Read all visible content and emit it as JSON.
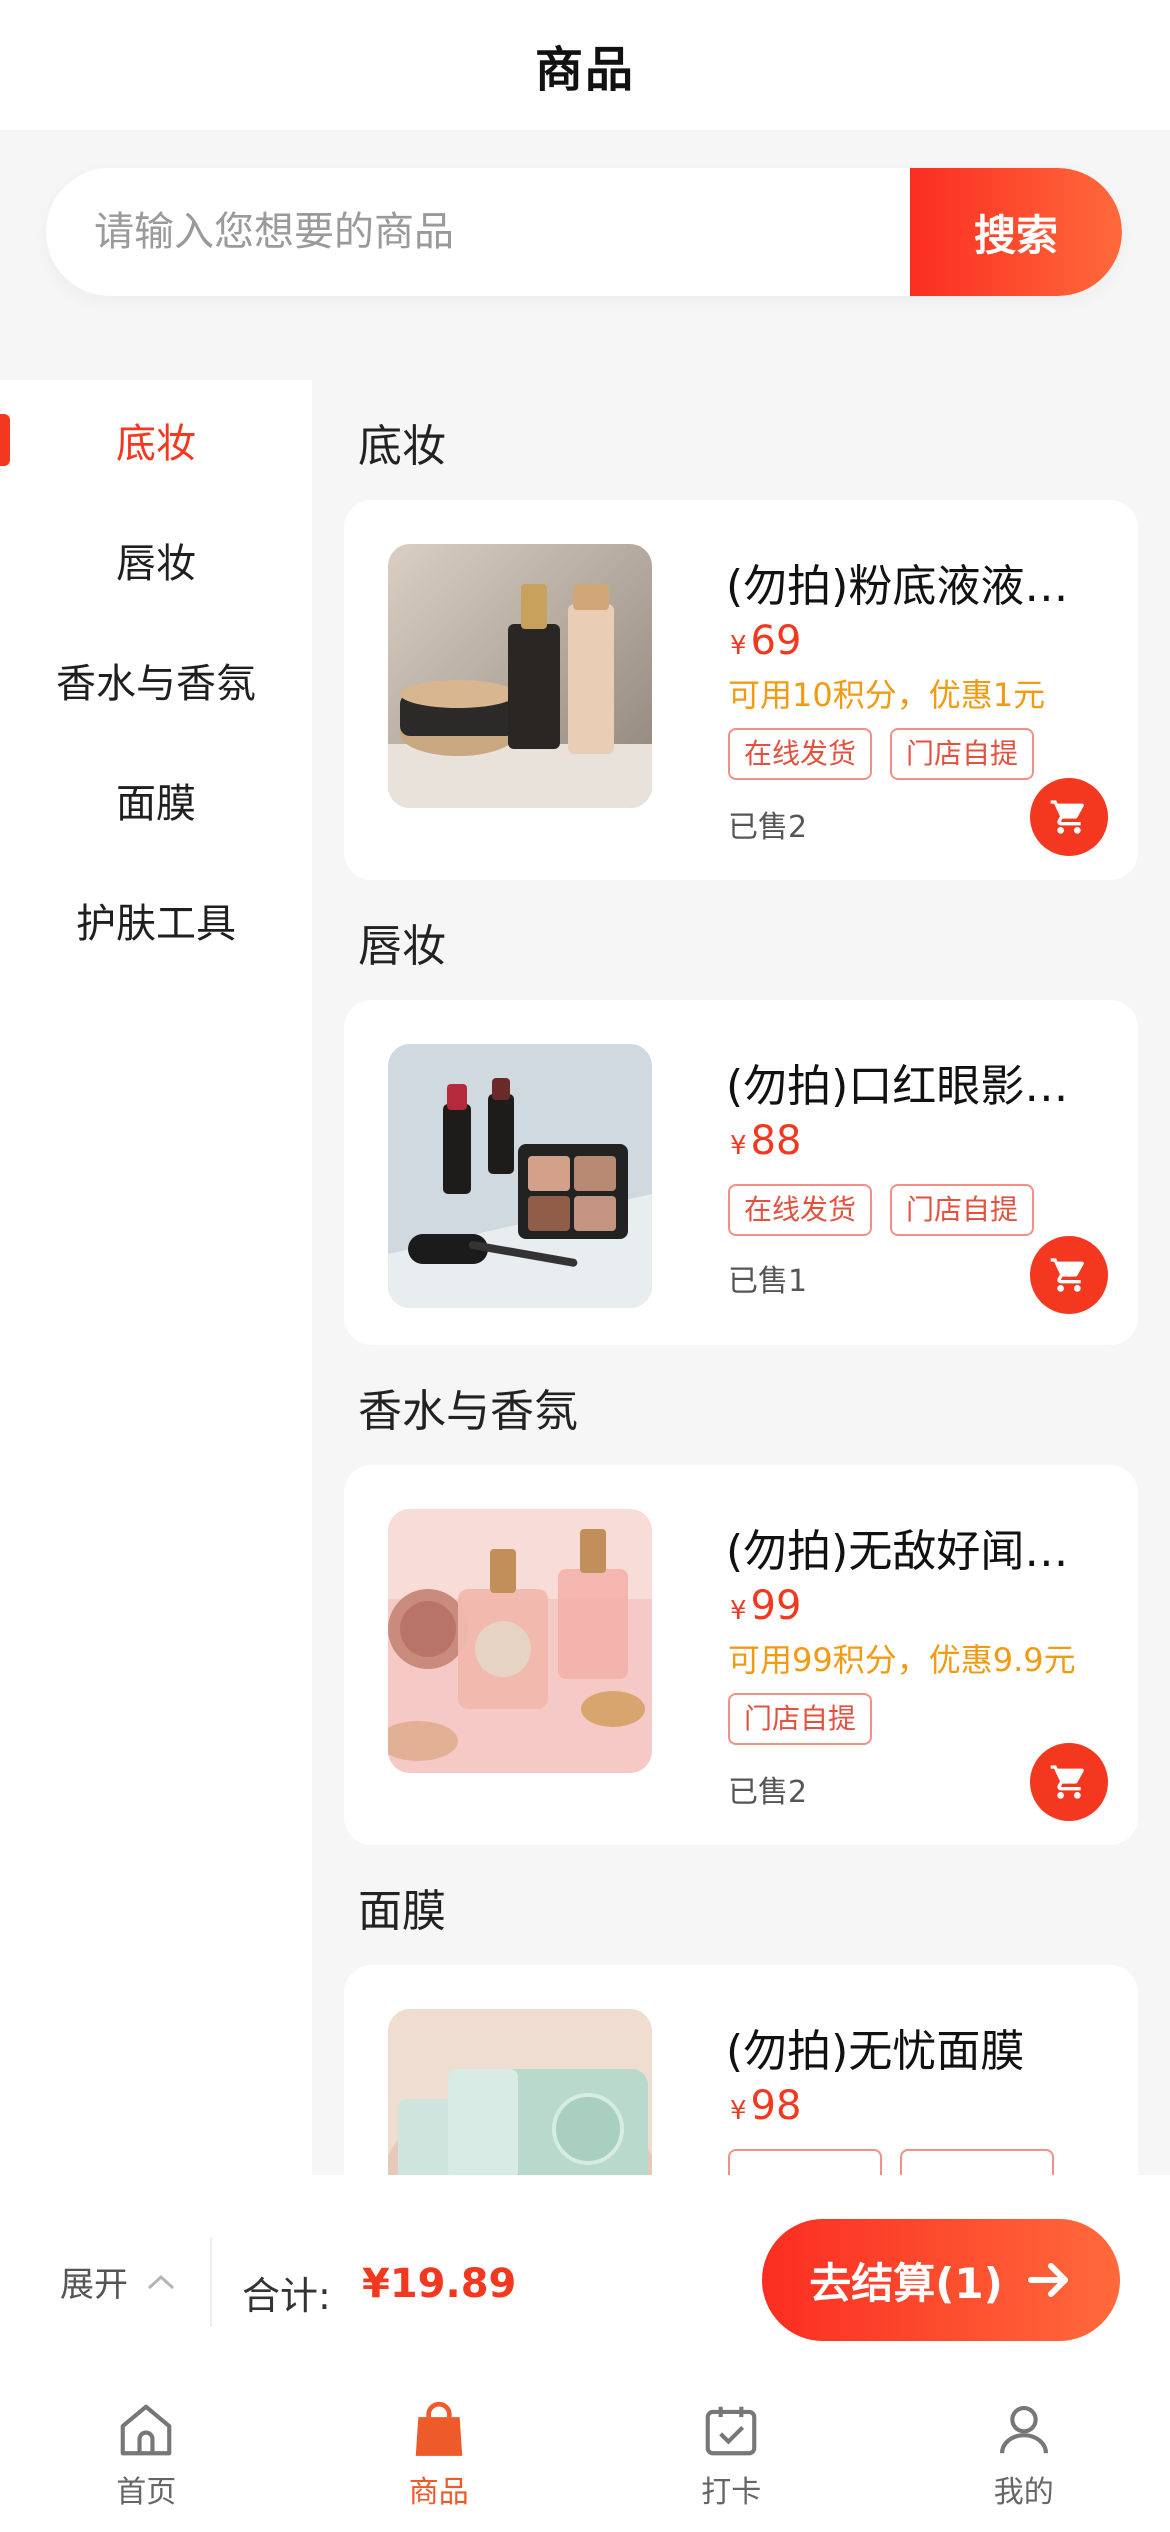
{
  "header": {
    "title": "商品"
  },
  "search": {
    "placeholder": "请输入您想要的商品",
    "button_label": "搜索"
  },
  "sidebar": {
    "items": [
      {
        "label": "底妆",
        "active": true
      },
      {
        "label": "唇妆",
        "active": false
      },
      {
        "label": "香水与香氛",
        "active": false
      },
      {
        "label": "面膜",
        "active": false
      },
      {
        "label": "护肤工具",
        "active": false
      }
    ]
  },
  "sections": [
    {
      "title": "底妆",
      "product": {
        "name": "(勿拍)粉底液液体粉底",
        "currency": "¥",
        "price": "69",
        "points_note": "可用10积分，优惠1元",
        "tags": [
          "在线发货",
          "门店自提"
        ],
        "sold": "已售2"
      }
    },
    {
      "title": "唇妆",
      "product": {
        "name": "(勿拍)口红眼影组合",
        "currency": "¥",
        "price": "88",
        "points_note": "",
        "tags": [
          "在线发货",
          "门店自提"
        ],
        "sold": "已售1"
      }
    },
    {
      "title": "香水与香氛",
      "product": {
        "name": "(勿拍)无敌好闻香水",
        "currency": "¥",
        "price": "99",
        "points_note": "可用99积分，优惠9.9元",
        "tags": [
          "门店自提"
        ],
        "sold": "已售2"
      }
    },
    {
      "title": "面膜",
      "product": {
        "name": "(勿拍)无忧面膜",
        "currency": "¥",
        "price": "98",
        "points_note": "",
        "tags": [
          "",
          ""
        ],
        "sold": ""
      }
    }
  ],
  "checkout": {
    "expand_label": "展开",
    "total_label": "合计:",
    "total_amount": "¥19.89",
    "pay_label": "去结算(1)"
  },
  "tabbar": {
    "items": [
      {
        "label": "首页",
        "icon": "home-icon",
        "active": false
      },
      {
        "label": "商品",
        "icon": "shopping-bag-icon",
        "active": true
      },
      {
        "label": "打卡",
        "icon": "calendar-check-icon",
        "active": false
      },
      {
        "label": "我的",
        "icon": "user-icon",
        "active": false
      }
    ]
  },
  "colors": {
    "accent": "#f4371f",
    "points": "#f39a13",
    "tab_active": "#ef5a2a"
  }
}
